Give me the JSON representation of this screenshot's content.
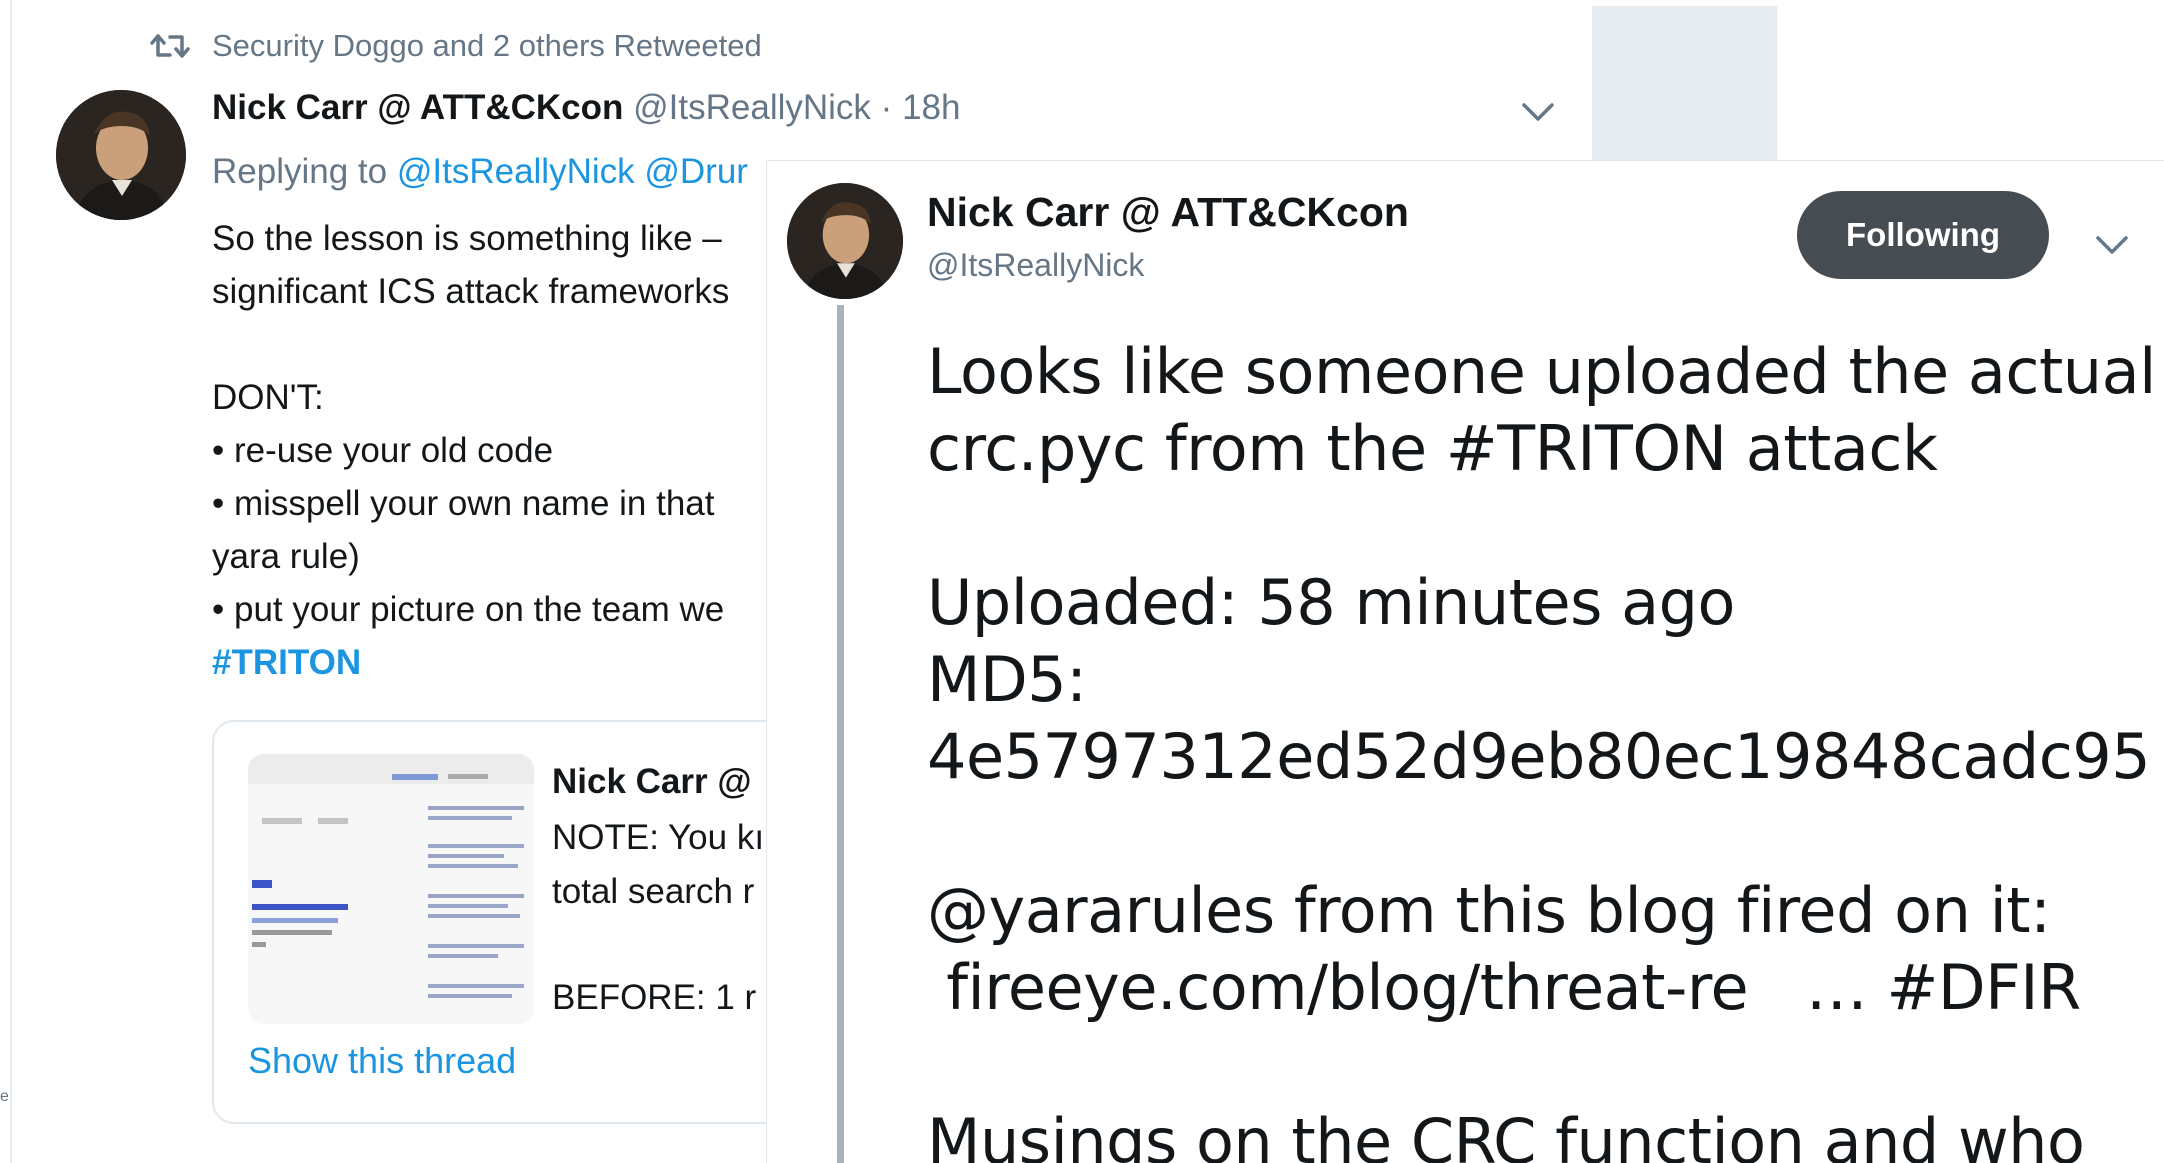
{
  "gutter_letter": "e",
  "retweet_context": "Security Doggo and 2 others Retweeted",
  "background_tweet": {
    "name": "Nick Carr @ ATT&CKcon",
    "handle": "@ItsReallyNick",
    "separator": "·",
    "time": "18h",
    "replying_label": "Replying to",
    "reply_mention_1": "@ItsReallyNick",
    "reply_mention_2": "@Drur",
    "lines": [
      "So the lesson is something like –",
      "significant ICS attack frameworks",
      "",
      "DON'T:",
      "• re-use your old code",
      "• misspell your own name in that",
      "yara rule)",
      "• put your picture on the team we"
    ],
    "hashtag": "#TRITON",
    "quote": {
      "name": "Nick Carr @",
      "line1": "NOTE: You kı",
      "line2": "total search r",
      "line3": "BEFORE: 1 r",
      "show_thread": "Show this thread"
    }
  },
  "popup_tweet": {
    "name": "Nick Carr @ ATT&CKcon",
    "handle": "@ItsReallyNick",
    "follow_label": "Following",
    "lines": [
      "Looks like someone uploaded the actual",
      "crc.pyc from the #TRITON attack",
      "",
      "Uploaded: 58 minutes ago",
      "MD5:",
      "4e5797312ed52d9eb80ec19848cadc95",
      "",
      "@yararules from this blog fired on it:",
      " fireeye.com/blog/threat-re   … #DFIR",
      "",
      "Musings on the CRC function and who"
    ]
  },
  "colors": {
    "link_blue": "#1b95e0",
    "muted_gray": "#657786",
    "button_dark": "#454c52"
  },
  "icons": [
    "retweet-icon",
    "chevron-down-icon"
  ]
}
